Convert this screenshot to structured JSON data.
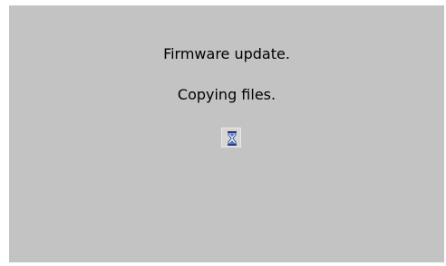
{
  "screen": {
    "title": "Firmware update.",
    "status": "Copying files.",
    "busy_icon": "hourglass-icon",
    "background_color": "#c3c3c3"
  }
}
